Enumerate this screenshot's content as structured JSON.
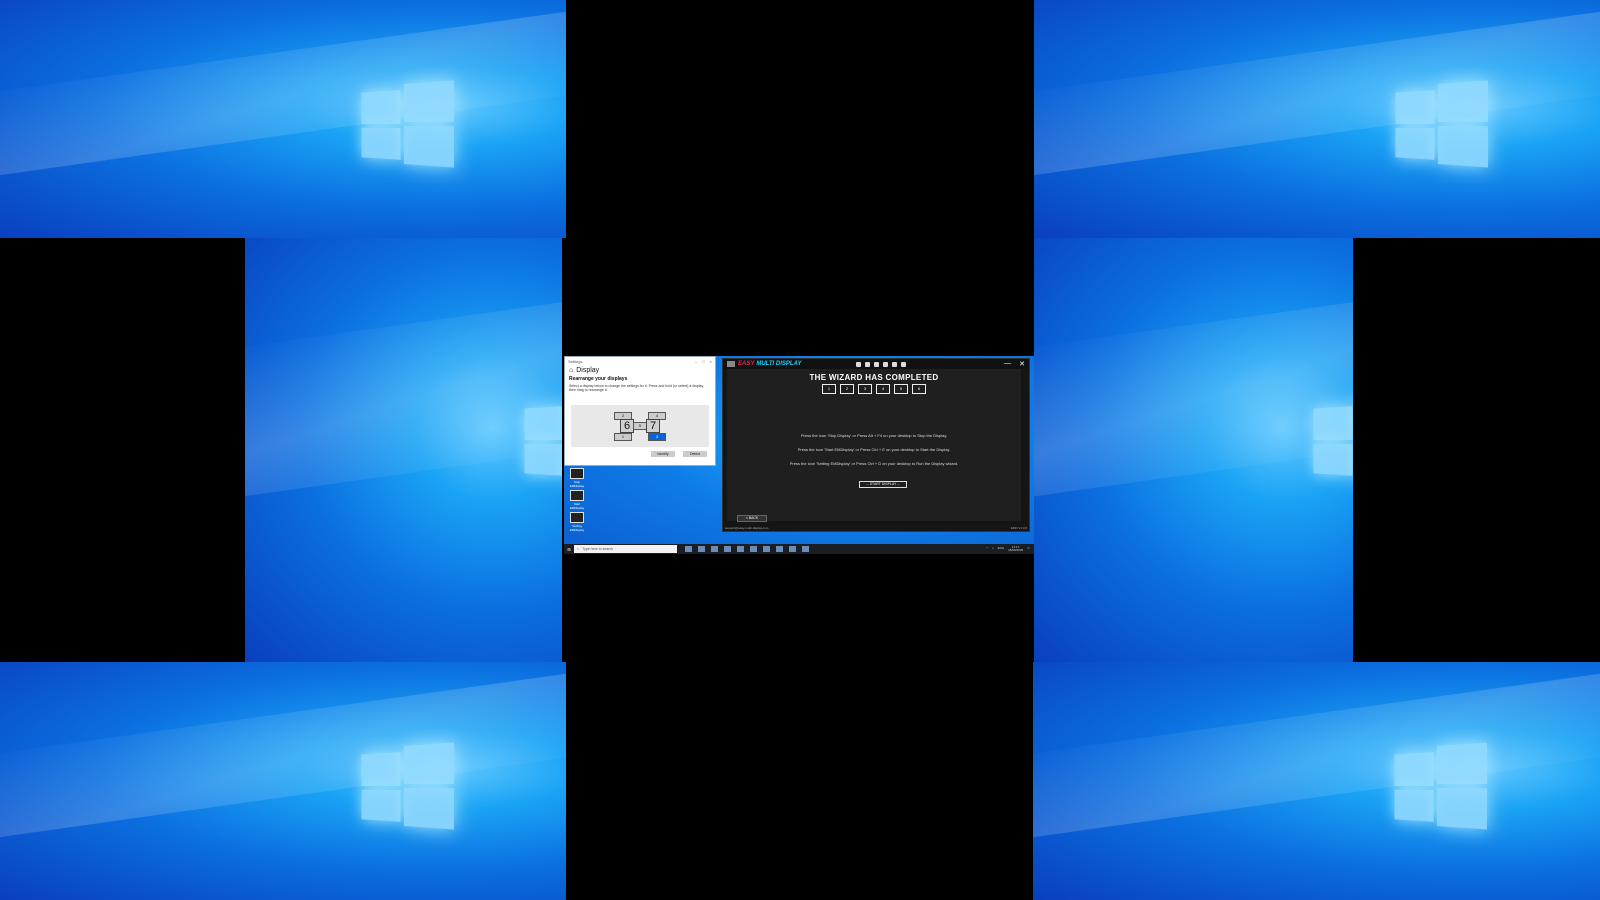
{
  "settings": {
    "window_title": "Settings",
    "heading": "Display",
    "subheading": "Rearrange your displays",
    "instructions": "Select a display below to change the settings for it. Press and hold (or select) a display, then drag to rearrange it.",
    "display_numbers": [
      "2",
      "4",
      "6",
      "5",
      "7",
      "1",
      "3"
    ],
    "identify_label": "Identify",
    "detect_label": "Detect"
  },
  "desktop_icons": [
    "Stop EMDisplay",
    "Start EMDisplay",
    "Setting EMDisplay"
  ],
  "emd": {
    "brand_part1": "EASY",
    "brand_part2": "MULTI DISPLAY",
    "title": "THE WIZARD HAS COMPLETED",
    "monitors": [
      "1",
      "2",
      "3",
      "4",
      "5",
      "6"
    ],
    "instruction1": "Press the icon 'Stop Display' or Press Alt + F4 on your desktop to Stop the Display.",
    "instruction2": "Press the icon 'Start EMDisplay' or Press Ctrl + E on your desktop to Start the Display.",
    "instruction3": "Press the icon 'Setting EMDisplay' or Press Ctrl + D on your desktop to Run the Display wizard.",
    "start_button": "-- START DISPLAY --",
    "back_button": "< BACK",
    "status_left": "support@easy-multi-display.com",
    "status_right": "EMD V1.0.8"
  },
  "taskbar": {
    "search_placeholder": "Type here to search",
    "tray_lang": "ENG",
    "clock_time": "17:17",
    "clock_date": "18/06/2020"
  }
}
